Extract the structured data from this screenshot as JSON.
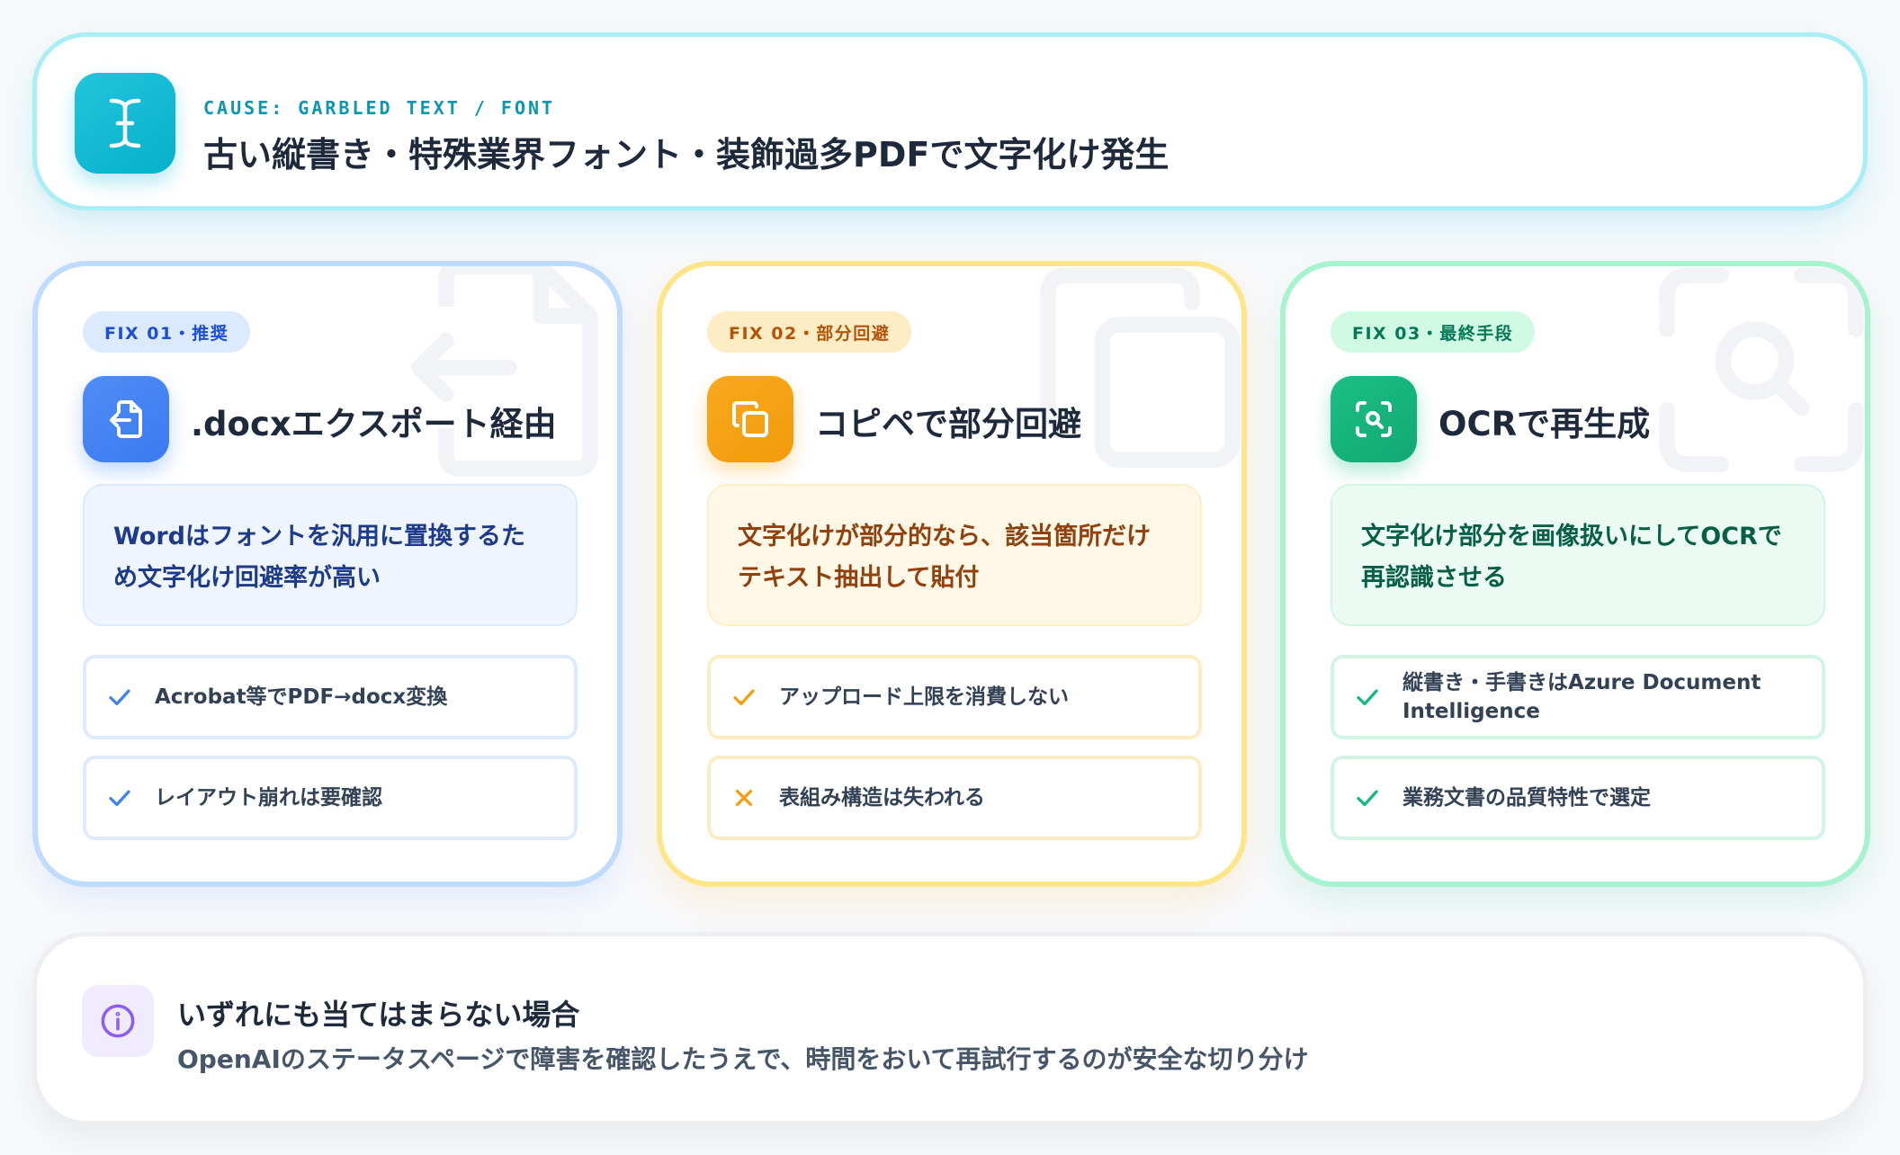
{
  "cause": {
    "eyebrow": "CAUSE: GARBLED TEXT / FONT",
    "title": "古い縦書き・特殊業界フォント・装飾過多PDFで文字化け発生",
    "icon": "text-cursor-icon",
    "color": "#06b6d4"
  },
  "fixes": [
    {
      "badge": "FIX 01・推奨",
      "title": ".docxエクスポート経由",
      "icon": "file-export-icon",
      "color": "#3b82f6",
      "description": "Wordはフォントを汎用に置換するため文字化け回避率が高い",
      "items": [
        {
          "mark": "check",
          "text": "Acrobat等でPDF→docx変換"
        },
        {
          "mark": "check",
          "text": "レイアウト崩れは要確認"
        }
      ]
    },
    {
      "badge": "FIX 02・部分回避",
      "title": "コピペで部分回避",
      "icon": "copy-icon",
      "color": "#f59e0b",
      "description": "文字化けが部分的なら、該当箇所だけテキスト抽出して貼付",
      "items": [
        {
          "mark": "check",
          "text": "アップロード上限を消費しない"
        },
        {
          "mark": "cross",
          "text": "表組み構造は失われる"
        }
      ]
    },
    {
      "badge": "FIX 03・最終手段",
      "title": "OCRで再生成",
      "icon": "scan-search-icon",
      "color": "#10b981",
      "description": "文字化け部分を画像扱いにしてOCRで再認識させる",
      "items": [
        {
          "mark": "check",
          "text": "縦書き・手書きはAzure Document Intelligence"
        },
        {
          "mark": "check",
          "text": "業務文書の品質特性で選定"
        }
      ]
    }
  ],
  "note": {
    "icon": "info-icon",
    "color": "#8b5cf6",
    "title": "いずれにも当てはまらない場合",
    "text": "OpenAIのステータスページで障害を確認したうえで、時間をおいて再試行するのが安全な切り分け"
  }
}
